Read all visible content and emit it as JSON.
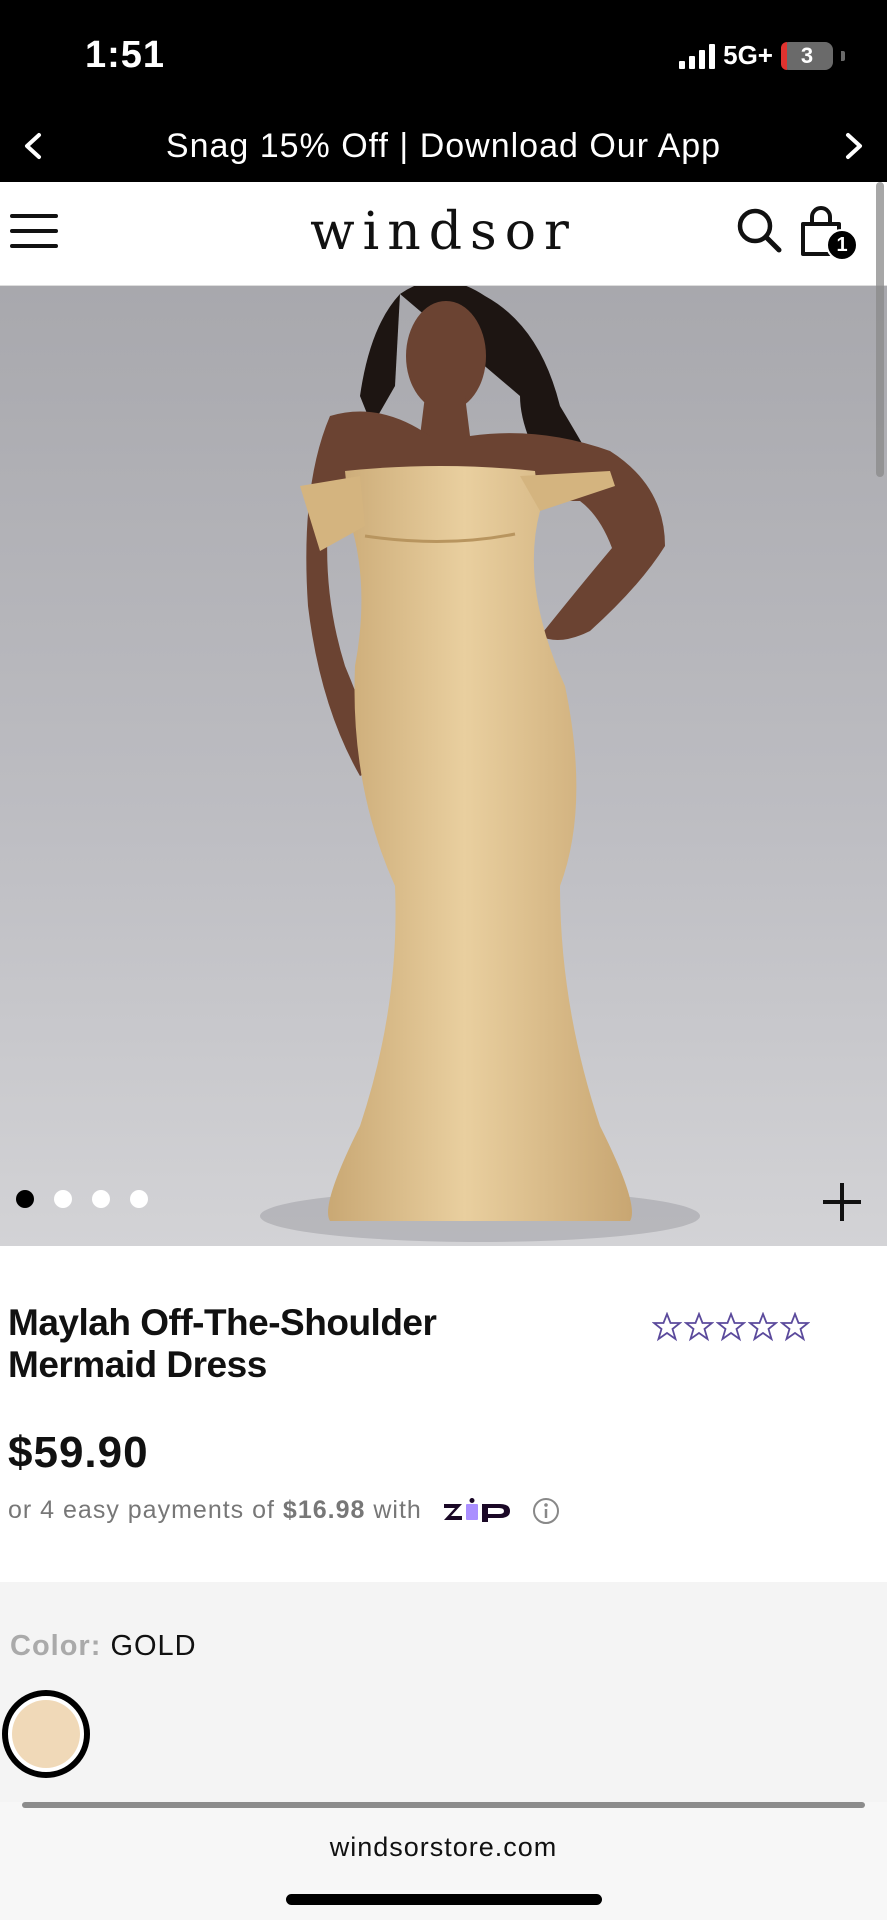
{
  "status_bar": {
    "time": "1:51",
    "network": "5G+",
    "battery": "3"
  },
  "promo": {
    "text": "Snag 15% Off | Download Our App",
    "prev_icon": "chevron-left-icon",
    "next_icon": "chevron-right-icon"
  },
  "header": {
    "logo": "windsor",
    "menu_icon": "hamburger-menu-icon",
    "search_icon": "search-icon",
    "bag_icon": "shopping-bag-icon",
    "bag_count": "1"
  },
  "gallery": {
    "image": "Model wearing gold off-the-shoulder mermaid dress",
    "slide_count": 4,
    "active_slide": 1,
    "zoom_icon": "plus-icon"
  },
  "product": {
    "title": "Maylah Off-The-Shoulder Mermaid Dress",
    "rating_stars": 0,
    "rating_max": 5,
    "price_symbol": "$",
    "price_value": "59.90",
    "installment_prefix": "or 4 easy payments of",
    "installment_amount": "$16.98",
    "installment_suffix": "with",
    "zip_logo": "ZIP",
    "info_icon": "info-icon"
  },
  "color": {
    "label": "Color:",
    "value": "GOLD",
    "swatch": "#f0d9b8"
  },
  "browser": {
    "url": "windsorstore.com"
  },
  "colors": {
    "accent": "#000000",
    "star": "#5b4a9c",
    "zip_purple": "#aa8fff",
    "zip_dark": "#1a0826"
  }
}
